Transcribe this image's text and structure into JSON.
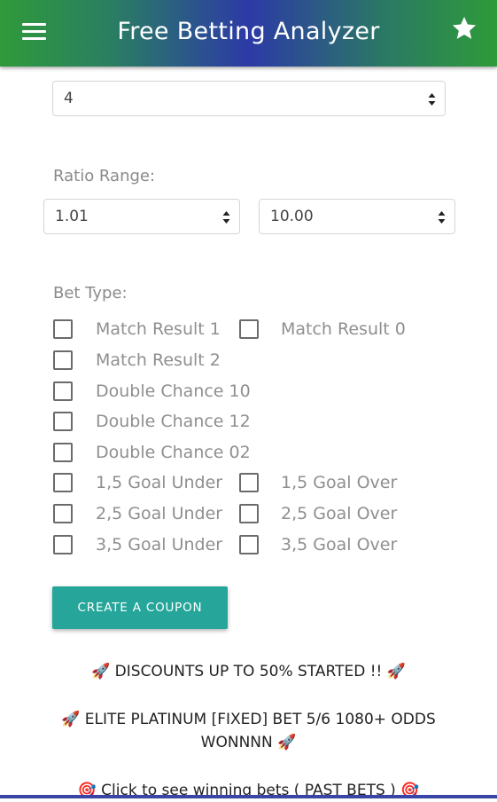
{
  "app": {
    "title": "Free Betting Analyzer"
  },
  "top_select": {
    "value": "4"
  },
  "ratio_range": {
    "label": "Ratio Range:",
    "min_value": "1.01",
    "max_value": "10.00"
  },
  "bet_type": {
    "label": "Bet Type:",
    "options": {
      "match_result_1": "Match Result 1",
      "match_result_0": "Match Result 0",
      "match_result_2": "Match Result 2",
      "double_chance_10": "Double Chance 10",
      "double_chance_12": "Double Chance 12",
      "double_chance_02": "Double Chance 02",
      "goal_under_1_5": "1,5 Goal Under",
      "goal_over_1_5": "1,5 Goal Over",
      "goal_under_2_5": "2,5 Goal Under",
      "goal_over_2_5": "2,5 Goal Over",
      "goal_under_3_5": "3,5 Goal Under",
      "goal_over_3_5": "3,5 Goal Over"
    }
  },
  "coupon_button": {
    "label": "CREATE A COUPON"
  },
  "promos": {
    "discount": "DISCOUNTS UP TO 50% STARTED !!",
    "elite_line1": "ELITE PLATINUM [FIXED] BET 5/6 1080+ ODDS",
    "elite_line2": "WONNNN",
    "past_bets": "Click to see winning bets ( PAST BETS )"
  },
  "colors": {
    "accent": "#26a69a",
    "appbar_green": "#2f9a3a",
    "appbar_blue": "#2c3aa6"
  }
}
